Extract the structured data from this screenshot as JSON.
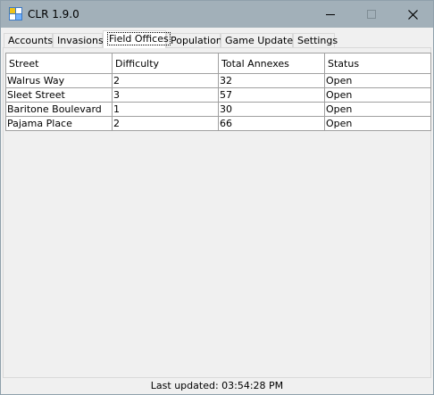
{
  "window": {
    "title": "CLR 1.9.0"
  },
  "title_buttons": {
    "minimize": "minimize-icon",
    "maximize": "maximize-icon",
    "close": "close-icon"
  },
  "tabs": [
    {
      "label": "Accounts"
    },
    {
      "label": "Invasions"
    },
    {
      "label": "Field Offices"
    },
    {
      "label": "Population"
    },
    {
      "label": "Game Updates"
    },
    {
      "label": "Settings"
    }
  ],
  "selected_tab": "Field Offices",
  "table": {
    "columns": [
      "Street",
      "Difficulty",
      "Total Annexes",
      "Status"
    ],
    "rows": [
      [
        "Walrus Way",
        "2",
        "32",
        "Open"
      ],
      [
        "Sleet Street",
        "3",
        "57",
        "Open"
      ],
      [
        "Baritone Boulevard",
        "1",
        "30",
        "Open"
      ],
      [
        "Pajama Place",
        "2",
        "66",
        "Open"
      ]
    ]
  },
  "status_bar": {
    "text": "Last updated: 03:54:28 PM"
  },
  "colors": {
    "titlebar": "#a2b0b9",
    "window_bg": "#f0f0f0",
    "grid_line": "#a0a0a0"
  }
}
